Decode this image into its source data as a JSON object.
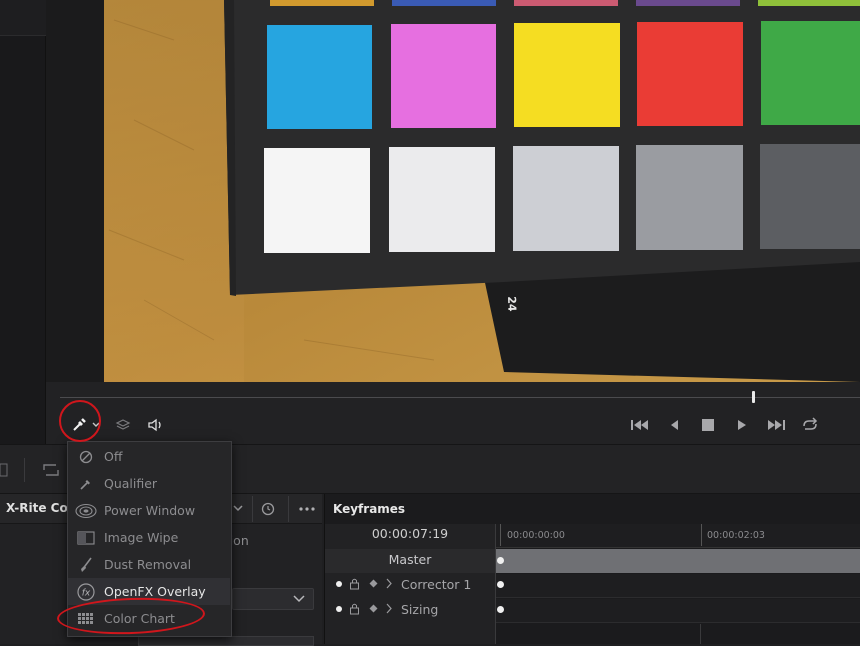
{
  "transport": {
    "icons": [
      "eyedropper-icon",
      "layers-icon",
      "speaker-icon",
      "skip-start-icon",
      "step-back-icon",
      "stop-icon",
      "play-icon",
      "skip-end-icon",
      "loop-icon"
    ]
  },
  "tool_menu": {
    "items": [
      {
        "label": "Off",
        "icon": "off-icon",
        "highlighted": false
      },
      {
        "label": "Qualifier",
        "icon": "eyedropper-icon",
        "highlighted": false
      },
      {
        "label": "Power Window",
        "icon": "power-window-icon",
        "highlighted": false
      },
      {
        "label": "Image Wipe",
        "icon": "image-wipe-icon",
        "highlighted": false
      },
      {
        "label": "Dust Removal",
        "icon": "brush-icon",
        "highlighted": false
      },
      {
        "label": "OpenFX Overlay",
        "icon": "fx-icon",
        "highlighted": true
      },
      {
        "label": "Color Chart",
        "icon": "color-chart-icon",
        "highlighted": false
      }
    ]
  },
  "panel": {
    "title": "X-Rite Color",
    "calibration_label": "ration"
  },
  "keyframes": {
    "title": "Keyframes",
    "timecode": "00:00:07:19",
    "ruler_start": "00:00:00:00",
    "ruler_mid": "00:00:02:03",
    "rows": [
      {
        "label": "Master"
      },
      {
        "label": "Corrector 1"
      },
      {
        "label": "Sizing"
      }
    ]
  },
  "chart_number": "24",
  "colors": {
    "annotation": "#d0161c",
    "swatch_cyan": "#26a5e0",
    "swatch_magenta": "#e66fe0",
    "swatch_yellow": "#f5dd22",
    "swatch_red": "#ea3c35",
    "swatch_green": "#3fa947"
  }
}
